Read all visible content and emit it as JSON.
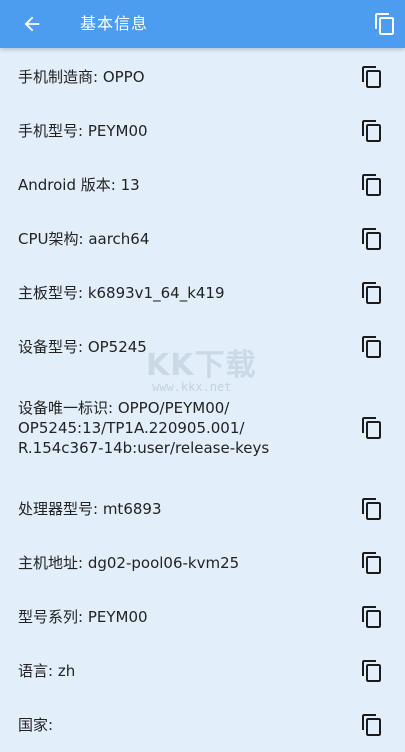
{
  "appbar": {
    "title": "基本信息",
    "back_icon": "arrow-left-icon",
    "copy_all_icon": "copy-icon",
    "background": "#4c9cf0"
  },
  "items": [
    {
      "text": "手机制造商: OPPO"
    },
    {
      "text": "手机型号: PEYM00"
    },
    {
      "text": "Android 版本: 13"
    },
    {
      "text": "CPU架构: aarch64"
    },
    {
      "text": "主板型号: k6893v1_64_k419"
    },
    {
      "text": "设备型号: OP5245"
    },
    {
      "text": "设备唯一标识: OPPO/PEYM00/\nOP5245:13/TP1A.220905.001/\nR.154c367-14b:user/release-keys"
    },
    {
      "text": "处理器型号: mt6893"
    },
    {
      "text": "主机地址: dg02-pool06-kvm25"
    },
    {
      "text": "型号系列: PEYM00"
    },
    {
      "text": "语言: zh"
    },
    {
      "text": "国家:"
    }
  ],
  "watermark": {
    "logo": "KK下载",
    "url": "www.kkx.net"
  },
  "colors": {
    "page_background": "#e2effb",
    "text": "#222222"
  }
}
